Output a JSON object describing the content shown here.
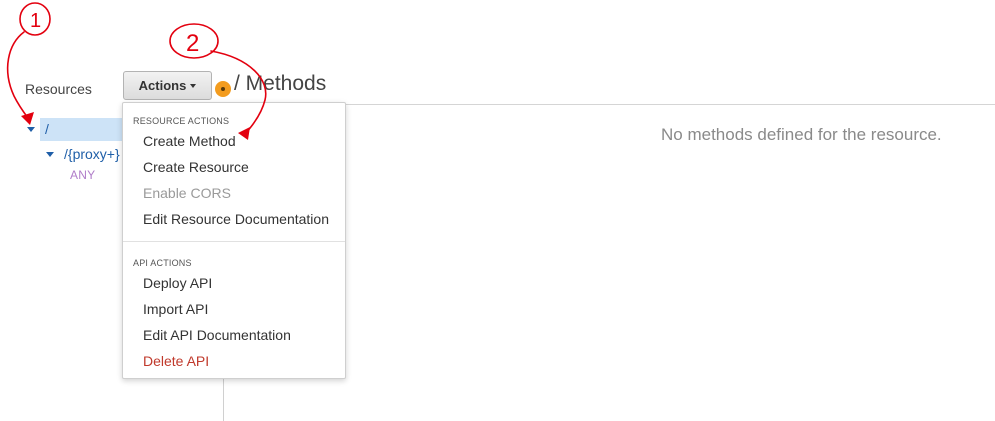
{
  "resources_panel": {
    "title": "Resources",
    "tree": {
      "root": {
        "label": "/"
      },
      "child": {
        "label": "/{proxy+}",
        "method": "ANY"
      }
    }
  },
  "toolbar": {
    "actions_label": "Actions"
  },
  "main": {
    "title": "/ Methods",
    "empty_message": "No methods defined for the resource."
  },
  "actions_menu": {
    "resource_section": "RESOURCE ACTIONS",
    "resource_items": [
      {
        "label": "Create Method",
        "state": "normal"
      },
      {
        "label": "Create Resource",
        "state": "normal"
      },
      {
        "label": "Enable CORS",
        "state": "disabled"
      },
      {
        "label": "Edit Resource Documentation",
        "state": "normal"
      }
    ],
    "api_section": "API ACTIONS",
    "api_items": [
      {
        "label": "Deploy API",
        "state": "normal"
      },
      {
        "label": "Import API",
        "state": "normal"
      },
      {
        "label": "Edit API Documentation",
        "state": "normal"
      },
      {
        "label": "Delete API",
        "state": "danger"
      }
    ]
  },
  "annotations": {
    "step1": "1",
    "step2": "2",
    "color": "#e3000f"
  },
  "colors": {
    "selected_row": "#cde3f7",
    "link_blue": "#1f5fa8",
    "method_purple": "#b07dc9",
    "danger_red": "#c0392b",
    "status_orange": "#f39c1f"
  }
}
